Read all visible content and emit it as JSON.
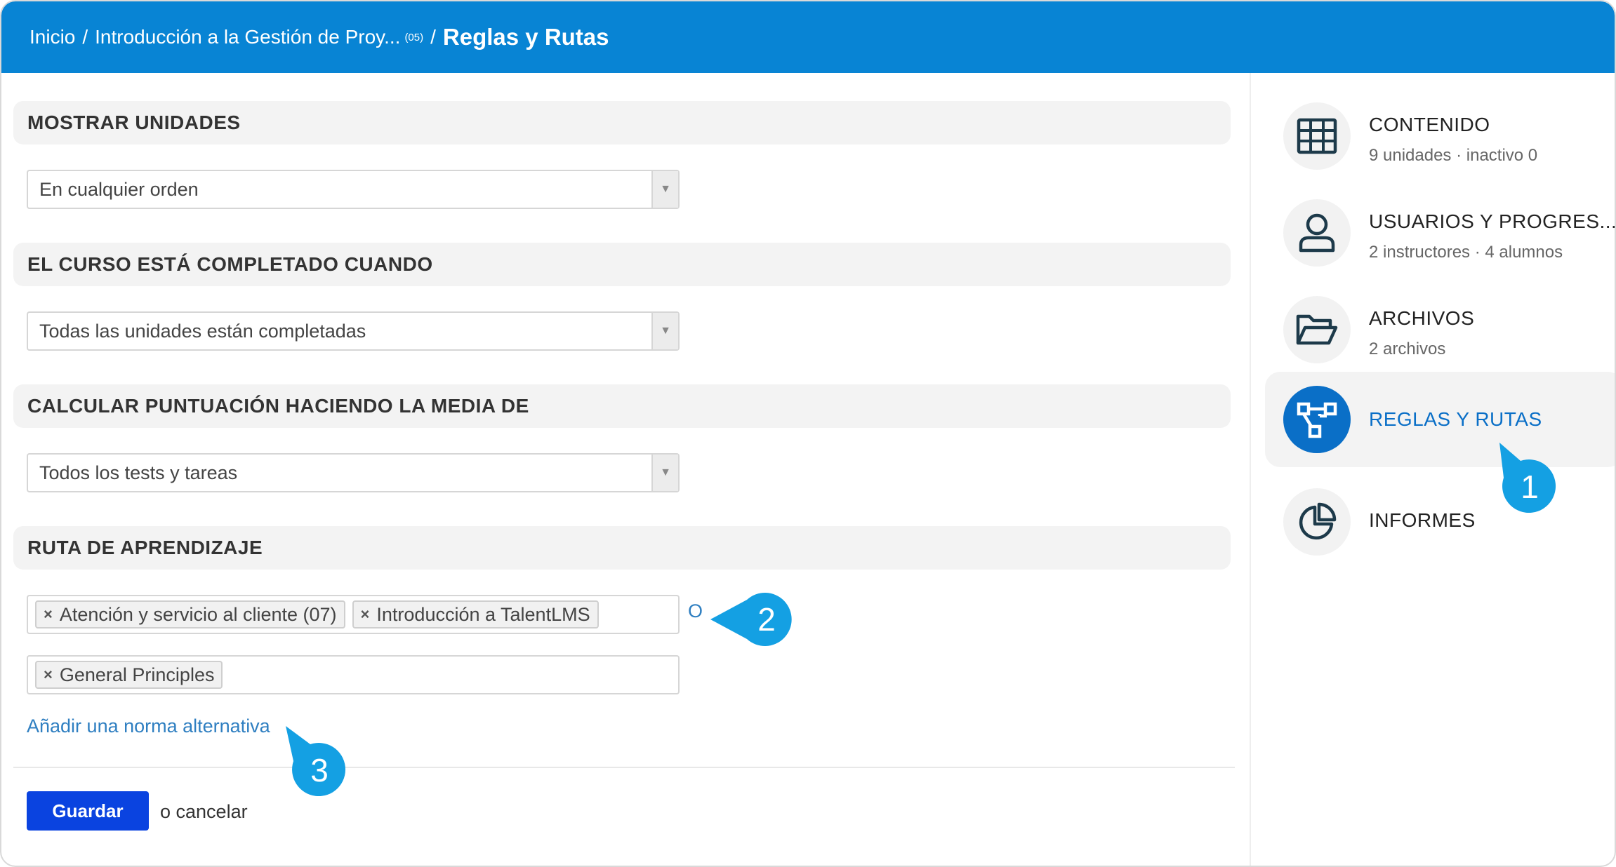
{
  "breadcrumb": {
    "home": "Inicio",
    "course": "Introducción a la Gestión de Proy...",
    "course_code": "(05)",
    "current": "Reglas y Rutas",
    "separator": "/"
  },
  "sections": {
    "show_units": {
      "heading": "MOSTRAR UNIDADES",
      "value": "En cualquier orden"
    },
    "completed_when": {
      "heading": "EL CURSO ESTÁ COMPLETADO CUANDO",
      "value": "Todas las unidades están completadas"
    },
    "score_average": {
      "heading": "CALCULAR PUNTUACIÓN HACIENDO LA MEDIA DE",
      "value": "Todos los tests y tareas"
    },
    "learning_path": {
      "heading": "RUTA DE APRENDIZAJE",
      "rule1_tags": [
        "Atención y servicio al cliente (07)",
        "Introducción a TalentLMS"
      ],
      "rule2_tags": [
        "General Principles"
      ],
      "or_label": "O",
      "add_alternative": "Añadir una norma alternativa"
    }
  },
  "actions": {
    "save": "Guardar",
    "cancel": "o cancelar"
  },
  "sidebar": {
    "items": [
      {
        "title": "CONTENIDO",
        "subtitle": "9 unidades · inactivo 0",
        "icon": "grid-icon"
      },
      {
        "title": "USUARIOS Y PROGRES...",
        "subtitle": "2 instructores · 4 alumnos",
        "icon": "user-icon"
      },
      {
        "title": "ARCHIVOS",
        "subtitle": "2 archivos",
        "icon": "folder-icon"
      },
      {
        "title": "REGLAS Y RUTAS",
        "subtitle": "",
        "icon": "flow-icon",
        "active": true
      },
      {
        "title": "INFORMES",
        "subtitle": "",
        "icon": "pie-chart-icon"
      }
    ]
  },
  "callouts": [
    "1",
    "2",
    "3"
  ],
  "colors": {
    "header": "#0884d4",
    "accent": "#0a6fc7",
    "save_button": "#0a43e0",
    "callout": "#14a0e3",
    "link": "#2f7fc1"
  }
}
